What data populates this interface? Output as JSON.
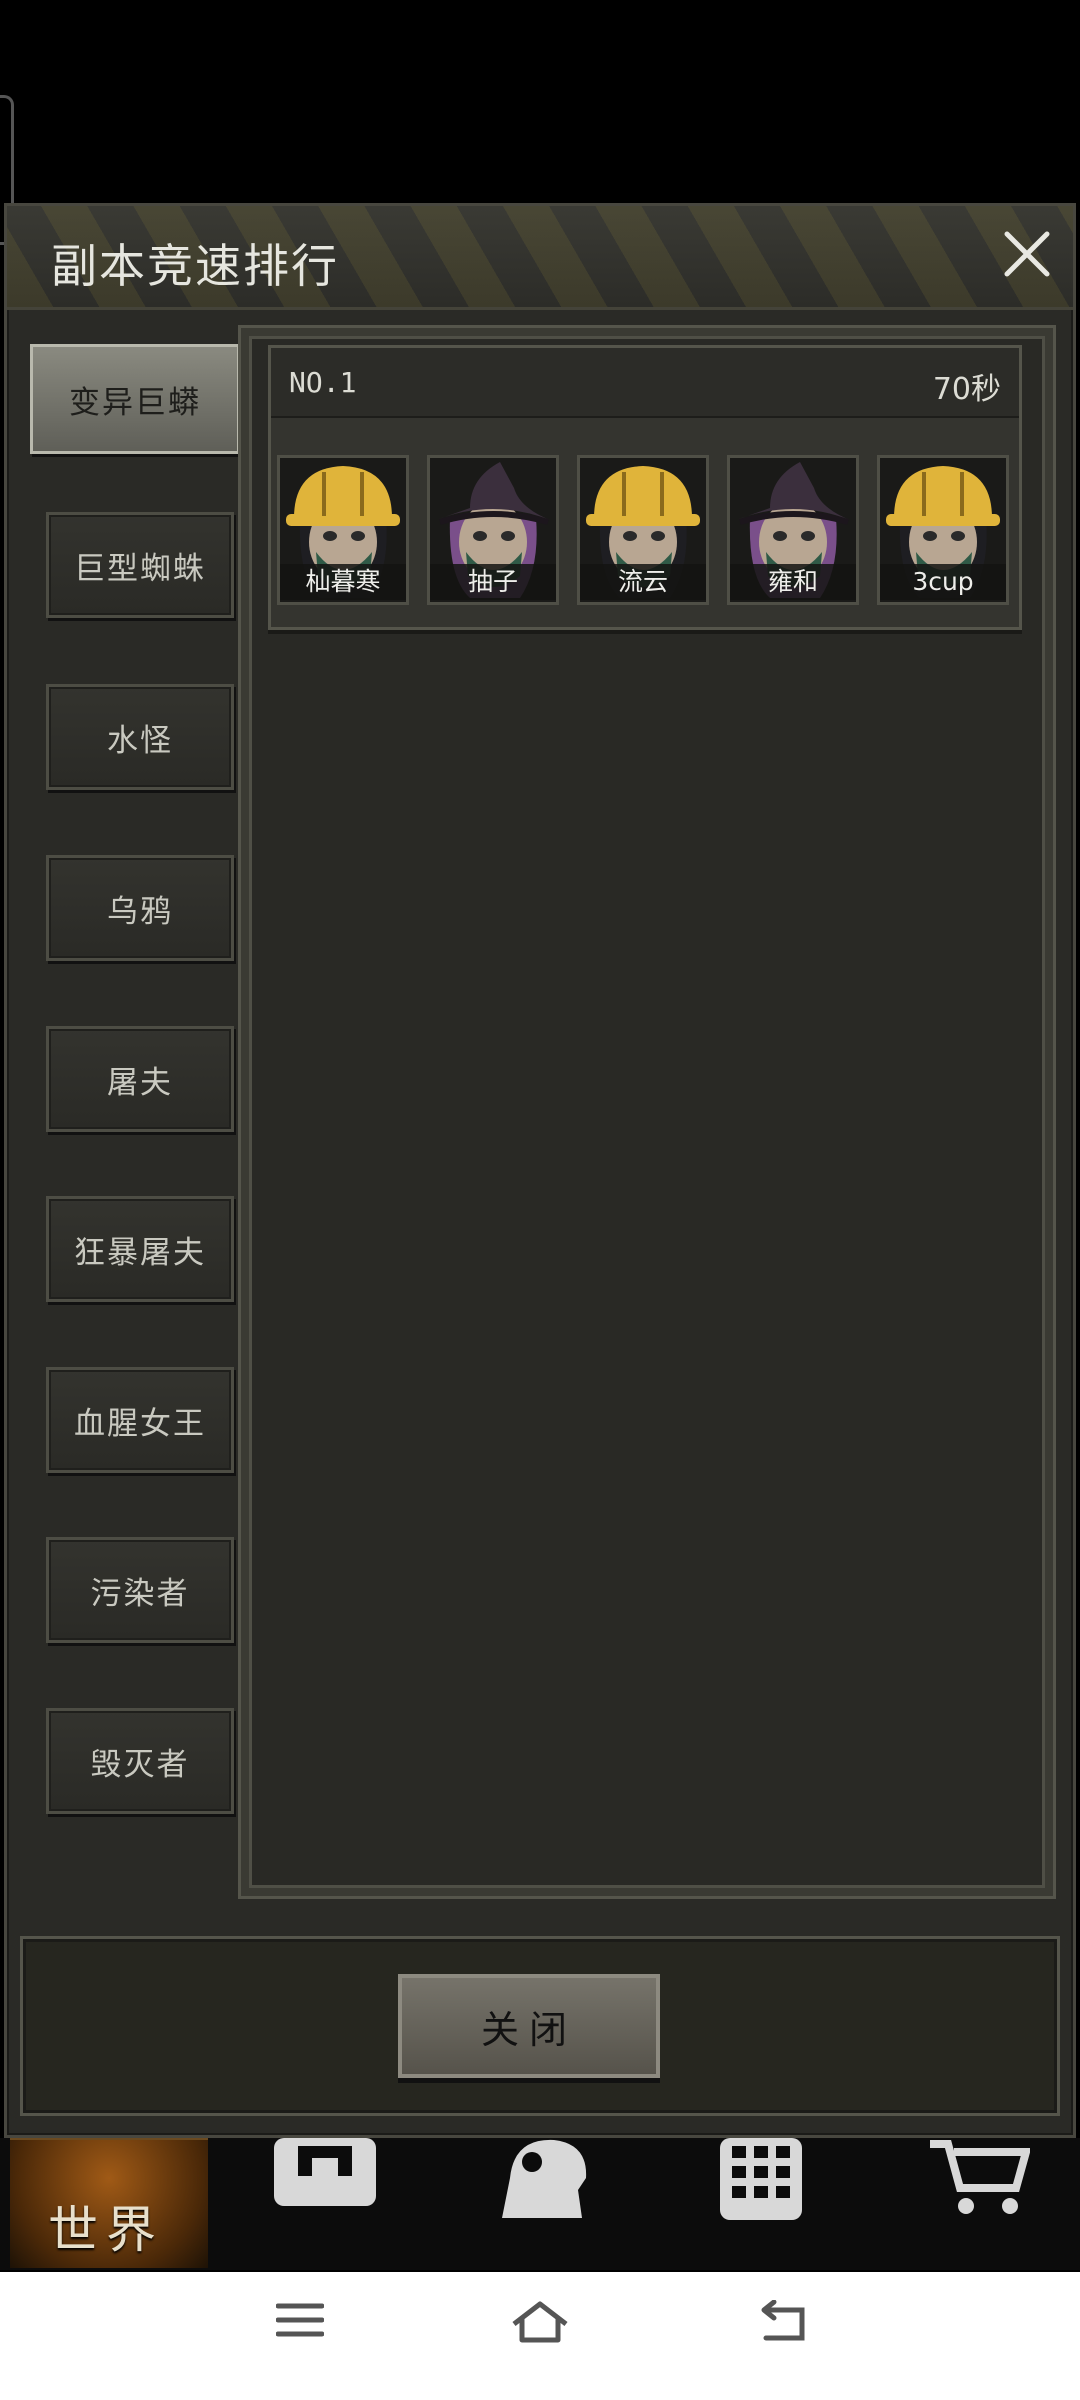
{
  "modal": {
    "title": "副本竞速排行",
    "close_button_label": "关闭"
  },
  "tabs": [
    {
      "label": "变异巨蟒",
      "active": true
    },
    {
      "label": "巨型蜘蛛",
      "active": false
    },
    {
      "label": "水怪",
      "active": false
    },
    {
      "label": "乌鸦",
      "active": false
    },
    {
      "label": "屠夫",
      "active": false
    },
    {
      "label": "狂暴屠夫",
      "active": false
    },
    {
      "label": "血腥女王",
      "active": false
    },
    {
      "label": "污染者",
      "active": false
    },
    {
      "label": "毁灭者",
      "active": false
    }
  ],
  "ranking": {
    "rank_label": "NO.1",
    "time": "70秒",
    "members": [
      {
        "name": "杣暮寒",
        "headgear": "hardhat"
      },
      {
        "name": "抽子",
        "headgear": "witch-hat"
      },
      {
        "name": "流云",
        "headgear": "hardhat"
      },
      {
        "name": "雍和",
        "headgear": "witch-hat"
      },
      {
        "name": "3cup",
        "headgear": "hardhat"
      }
    ]
  },
  "game_nav": {
    "world_label": "世界",
    "icons": [
      "backpack-icon",
      "character-icon",
      "building-icon",
      "shop-cart-icon"
    ]
  },
  "colors": {
    "hardhat": "#e0b43a",
    "witch_hat": "#3b2f3d",
    "mask": "#2f5a46",
    "world_tab": "#a05a16"
  }
}
